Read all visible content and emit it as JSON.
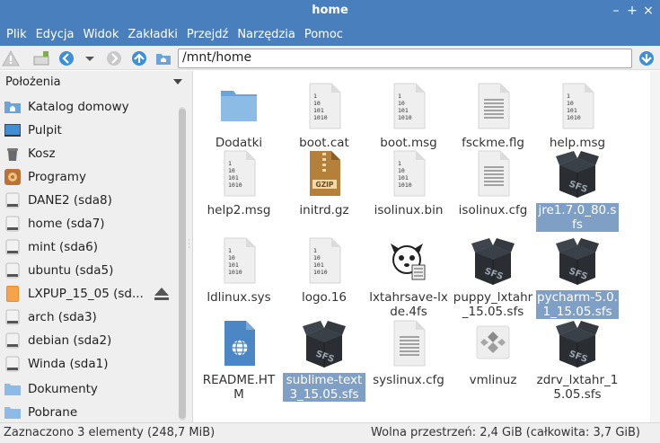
{
  "window": {
    "title": "home"
  },
  "menu": [
    "Plik",
    "Edycja",
    "Widok",
    "Zakładki",
    "Przejdź",
    "Narzędzia",
    "Pomoc"
  ],
  "toolbar": {
    "path": "/mnt/home"
  },
  "sidebar": {
    "header": "Położenia",
    "items": [
      {
        "label": "Katalog domowy",
        "icon": "home-folder-icon"
      },
      {
        "label": "Pulpit",
        "icon": "desktop-icon"
      },
      {
        "label": "Kosz",
        "icon": "trash-icon"
      },
      {
        "label": "Programy",
        "icon": "applications-icon"
      },
      {
        "label": "DANE2 (sda8)",
        "icon": "drive-icon"
      },
      {
        "label": "home (sda7)",
        "icon": "drive-icon"
      },
      {
        "label": "mint (sda6)",
        "icon": "drive-icon"
      },
      {
        "label": "ubuntu (sda5)",
        "icon": "drive-icon"
      },
      {
        "label": "LXPUP_15_05 (sd...",
        "icon": "usb-drive-icon"
      },
      {
        "label": "arch (sda3)",
        "icon": "drive-icon"
      },
      {
        "label": "debian (sda2)",
        "icon": "drive-icon"
      },
      {
        "label": "Winda (sda1)",
        "icon": "drive-icon"
      },
      {
        "label": "Dokumenty",
        "icon": "folder-icon"
      },
      {
        "label": "Pobrane",
        "icon": "folder-icon"
      }
    ]
  },
  "files": [
    {
      "label": "Dodatki",
      "type": "folder",
      "selected": false
    },
    {
      "label": "boot.cat",
      "type": "binary",
      "selected": false
    },
    {
      "label": "boot.msg",
      "type": "binary",
      "selected": false
    },
    {
      "label": "fsckme.flg",
      "type": "text",
      "selected": false
    },
    {
      "label": "help.msg",
      "type": "binary",
      "selected": false
    },
    {
      "label": "help2.msg",
      "type": "binary",
      "selected": false
    },
    {
      "label": "initrd.gz",
      "type": "archive",
      "selected": false
    },
    {
      "label": "isolinux.bin",
      "type": "binary",
      "selected": false
    },
    {
      "label": "isolinux.cfg",
      "type": "text",
      "selected": false
    },
    {
      "label": "jre1.7.0_80.sfs",
      "type": "sfs",
      "selected": true
    },
    {
      "label": "ldlinux.sys",
      "type": "binary",
      "selected": false
    },
    {
      "label": "logo.16",
      "type": "binary",
      "selected": false
    },
    {
      "label": "lxtahrsave-lxde.4fs",
      "type": "puppy",
      "selected": false
    },
    {
      "label": "puppy_lxtahr_15.05.sfs",
      "type": "sfs",
      "selected": false
    },
    {
      "label": "pycharm-5.0.1_15.05.sfs",
      "type": "sfs",
      "selected": true
    },
    {
      "label": "README.HTM",
      "type": "html",
      "selected": false
    },
    {
      "label": "sublime-text3_15.05.sfs",
      "type": "sfs",
      "selected": true
    },
    {
      "label": "syslinux.cfg",
      "type": "text",
      "selected": false
    },
    {
      "label": "vmlinuz",
      "type": "exec",
      "selected": false
    },
    {
      "label": "zdrv_lxtahr_15.05.sfs",
      "type": "sfs",
      "selected": false
    }
  ],
  "status": {
    "selection": "Zaznaczono 3 elementy (248,7 MiB)",
    "free_space": "Wolna przestrzeń: 2,4 GiB (całkowita: 3,7 GiB)"
  },
  "colors": {
    "titlebar": "#4a7fbe",
    "selection": "#7f9fc4",
    "folder": "#6aa4d8"
  }
}
